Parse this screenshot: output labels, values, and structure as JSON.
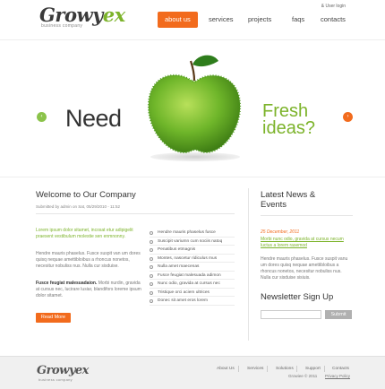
{
  "brand": {
    "logo_main": "Growy",
    "logo_accent": "ex",
    "tagline": "business company"
  },
  "header": {
    "user_login": "& User login"
  },
  "nav": [
    {
      "label": "about us",
      "active": true
    },
    {
      "label": "services"
    },
    {
      "label": "projects"
    },
    {
      "label": "faqs"
    },
    {
      "label": "contacts"
    }
  ],
  "hero": {
    "left_text": "Need",
    "right_line1": "Fresh",
    "right_line2": "ideas?",
    "prev": "‹",
    "next": "›"
  },
  "welcome": {
    "title": "Welcome to Our Company",
    "submitted": "Submitted by admin on Sat, 05/29/2010 - 11:52",
    "lead": "Lorem ipsum dolor sitamet, incosat etur adipigelit praesent vestibulum molestie sen enmnonny.",
    "para1": "Hendre mauris phaselus. Fusce suspit van um dores quisq nequae amettibloibus a rhoncus nonetos, necesitur nobuliss nus. Nulla cur sisduise.",
    "para2_bold": "Fusce feugiat malesuadaion.",
    "para2": "Morbi nurdin, gravida at cursus nec, lucirare lusiar, blandifors loreme ipsum dolor sitamet.",
    "read_more": "Read More"
  },
  "links": [
    "Hendre mauris phaselus fusce",
    "Suscipit variumn cum sociis natoq",
    "Penatibus etmagnis",
    "Montes, nascetur ridiculus mus",
    "Nulla amet maecenas",
    "Fusce feugiat malesuada adimon",
    "Nunc odio, gravida at cursus nec",
    "Tristique orci aciem ultrices",
    "Donec sit amet eros lorem"
  ],
  "news": {
    "title_line1": "Latest News &",
    "title_line2": "Events",
    "date": "25 December, 2011",
    "link": "Morbi nunc odio, gravida at cursus necum luctus a lorem rasemod",
    "para": "Hendre mauris phaselus. Fusce suspit vanu um dores quisq nequae amettibloibus a rhoncus nonetos, necesitur nobuliss nus. Nulla cur sisduise sisiuis."
  },
  "newsletter": {
    "title": "Newsletter Sign Up",
    "placeholder": "",
    "submit": "Submit"
  },
  "footer": {
    "logo_main": "Growy",
    "logo_accent": "ex",
    "tagline": "business company",
    "nav": [
      "About Us",
      "Services",
      "Solutions",
      "Support",
      "Contacts"
    ],
    "copyright": "Growiee © 2011",
    "privacy": "Privacy Policy"
  },
  "colors": {
    "accent_orange": "#f26b1d",
    "accent_green": "#7cb32a"
  }
}
